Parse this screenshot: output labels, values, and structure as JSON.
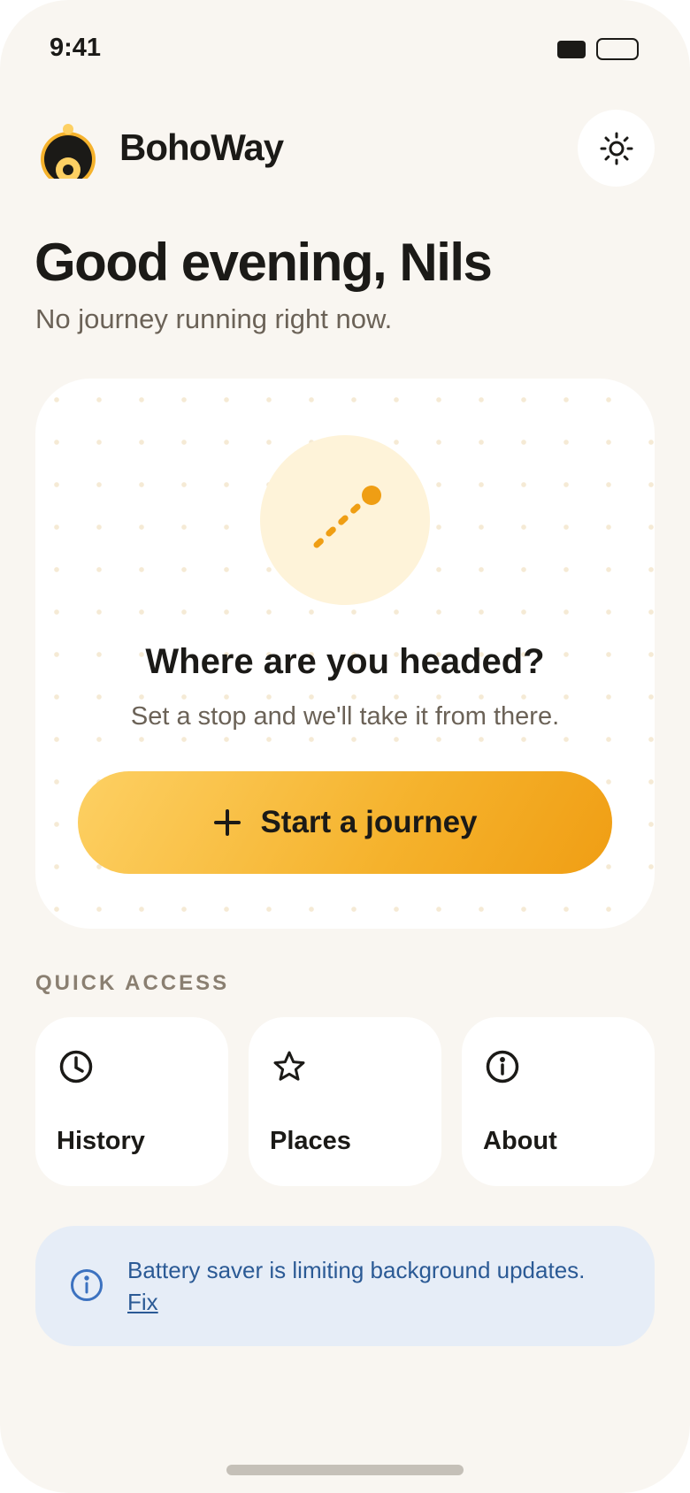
{
  "status_bar": {
    "time": "9:41"
  },
  "header": {
    "brand": "BohoWay",
    "theme_toggle_icon": "sun-icon"
  },
  "greeting": {
    "title": "Good evening, Nils",
    "subtitle": "No journey running right now."
  },
  "hero": {
    "title": "Where are you headed?",
    "subtitle": "Set a stop and we'll take it from there.",
    "button_label": "Start a journey",
    "button_icon": "plus-icon"
  },
  "quick_access": {
    "label": "QUICK ACCESS",
    "items": [
      {
        "label": "History",
        "icon": "clock-icon"
      },
      {
        "label": "Places",
        "icon": "star-icon"
      },
      {
        "label": "About",
        "icon": "info-icon"
      }
    ]
  },
  "banner": {
    "text": "Battery saver is limiting background updates.",
    "link": "Fix",
    "icon": "info-icon"
  },
  "colors": {
    "background": "#f9f6f1",
    "accent_start": "#fdd063",
    "accent_end": "#f09e14",
    "text_primary": "#1b1a17",
    "text_secondary": "#6b6257",
    "banner_bg": "#e6edf7",
    "banner_text": "#2b5a95"
  }
}
